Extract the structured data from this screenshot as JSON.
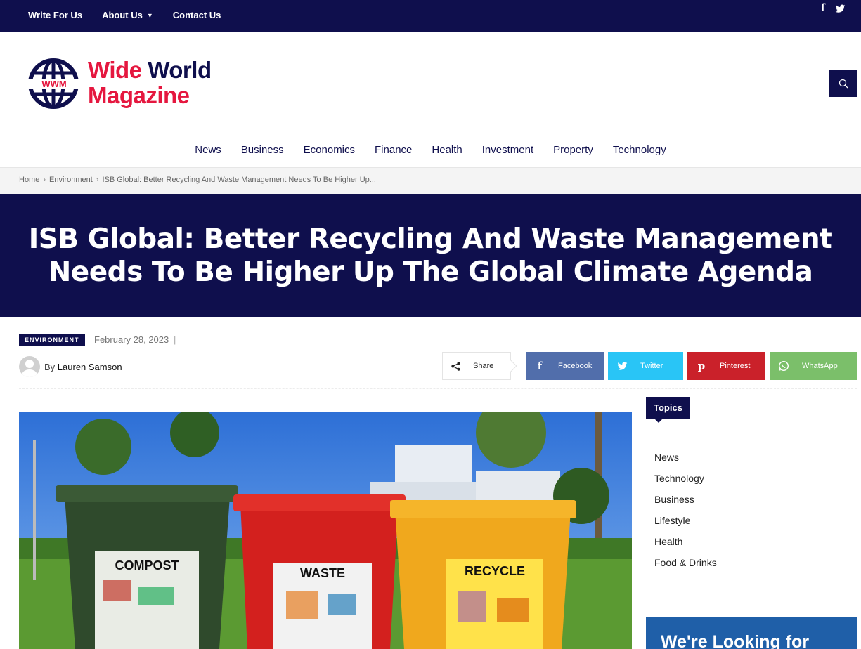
{
  "topbar": {
    "links": [
      {
        "label": "Write For Us"
      },
      {
        "label": "About Us",
        "has_dropdown": true
      },
      {
        "label": "Contact Us"
      }
    ],
    "social": [
      {
        "icon": "facebook-icon",
        "glyph": "f"
      },
      {
        "icon": "twitter-icon",
        "glyph": "t"
      }
    ]
  },
  "brand": {
    "logo_initials": "WWM",
    "name_line1_a": "Wide",
    "name_line1_b": "World",
    "name_line2": "Magazine"
  },
  "nav": {
    "items": [
      "News",
      "Business",
      "Economics",
      "Finance",
      "Health",
      "Investment",
      "Property",
      "Technology"
    ]
  },
  "breadcrumb": {
    "home": "Home",
    "section": "Environment",
    "current": "ISB Global: Better Recycling And Waste Management Needs To Be Higher Up..."
  },
  "article": {
    "title": "ISB Global: Better Recycling And Waste Management Needs To Be Higher Up The Global Climate Agenda",
    "category": "ENVIRONMENT",
    "date": "February 28, 2023",
    "date_separator": "|",
    "by": "By",
    "author": "Lauren Samson",
    "image_labels": [
      "COMPOST",
      "WASTE",
      "RECYCLE"
    ]
  },
  "share": {
    "label": "Share",
    "buttons": [
      {
        "label": "Facebook",
        "icon": "facebook-icon",
        "color": "#516eab"
      },
      {
        "label": "Twitter",
        "icon": "twitter-icon",
        "color": "#29c5f6"
      },
      {
        "label": "Pinterest",
        "icon": "pinterest-icon",
        "color": "#ca212a"
      },
      {
        "label": "WhatsApp",
        "icon": "whatsapp-icon",
        "color": "#7bbf6a"
      }
    ]
  },
  "sidebar": {
    "topics_title": "Topics",
    "topics": [
      "News",
      "Technology",
      "Business",
      "Lifestyle",
      "Health",
      "Food & Drinks"
    ],
    "promo_text": "We're Looking for"
  },
  "colors": {
    "navy": "#0f0f4d",
    "brand_red": "#e5173f"
  }
}
